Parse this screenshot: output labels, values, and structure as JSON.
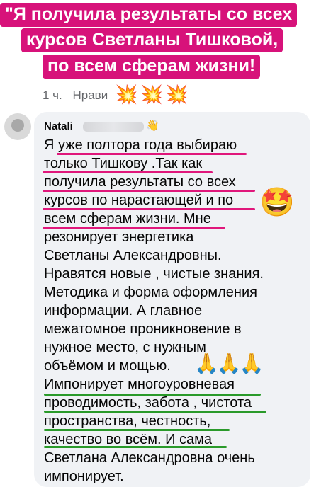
{
  "headline": {
    "lines": [
      "\"Я получила результаты со всех",
      "курсов Светланы Тишковой,",
      "по всем сферам жизни!"
    ],
    "background": "#d7127a"
  },
  "meta": {
    "time": "1 ч.",
    "like_label": "Нрави"
  },
  "comment": {
    "author": "Natali",
    "text_lines": [
      "Я уже полтора года выбираю",
      "только Тишкову .Так как",
      "получила результаты со всех",
      "курсов по нарастающей и по",
      "всем сферам жизни. Мне",
      "резонирует энергетика",
      "Светланы Александровны.",
      "Нравятся новые , чистые знания.",
      "Методика и форма оформления",
      "информации. А главное",
      "межатомное проникновение в",
      "нужное место, с нужным",
      "объёмом и мощью.",
      " Импонирует многоуровневая",
      "проводимость, забота , чистота",
      "пространства, честность,",
      "качество во всём. И сама",
      "Светлана Александровна очень",
      "импонирует."
    ]
  },
  "icons": {
    "burst": "💥",
    "star_eyes": "🤩",
    "praying_hands": "🙏",
    "wave": "👋"
  },
  "colors": {
    "pink_underline": "#e0177b",
    "green_underline": "#2a9a2a",
    "bubble": "#f0f2f5"
  }
}
